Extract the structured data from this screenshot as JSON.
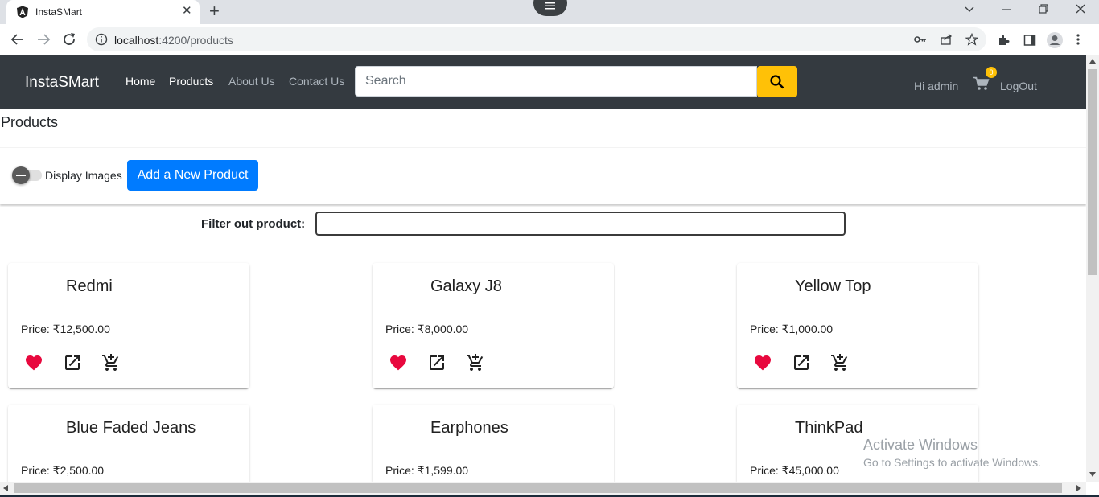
{
  "browser": {
    "tab_title": "InstaSMart",
    "url_host": "localhost",
    "url_path": ":4200/products"
  },
  "navbar": {
    "brand": "InstaSMart",
    "links": [
      {
        "label": "Home",
        "active": true
      },
      {
        "label": "Products",
        "active": true
      },
      {
        "label": "About Us",
        "active": false
      },
      {
        "label": "Contact Us",
        "active": false
      }
    ],
    "search_placeholder": "Search",
    "greeting": "Hi admin",
    "cart_count": "0",
    "logout": "LogOut"
  },
  "page": {
    "title": "Products",
    "toggle_label": "Display Images",
    "add_button": "Add a New Product",
    "filter_label": "Filter out product:",
    "filter_value": ""
  },
  "products": [
    {
      "name": "Redmi",
      "price": "Price: ₹12,500.00"
    },
    {
      "name": "Galaxy J8",
      "price": "Price: ₹8,000.00"
    },
    {
      "name": "Yellow Top",
      "price": "Price: ₹1,000.00"
    },
    {
      "name": "Blue Faded Jeans",
      "price": "Price: ₹2,500.00"
    },
    {
      "name": "Earphones",
      "price": "Price: ₹1,599.00"
    },
    {
      "name": "ThinkPad",
      "price": "Price: ₹45,000.00"
    }
  ],
  "watermark": {
    "line1": "Activate Windows",
    "line2": "Go to Settings to activate Windows."
  },
  "colors": {
    "navbar_bg": "#343a40",
    "search_button": "#ffc107",
    "primary": "#007bff",
    "favorite": "#e8083e"
  }
}
